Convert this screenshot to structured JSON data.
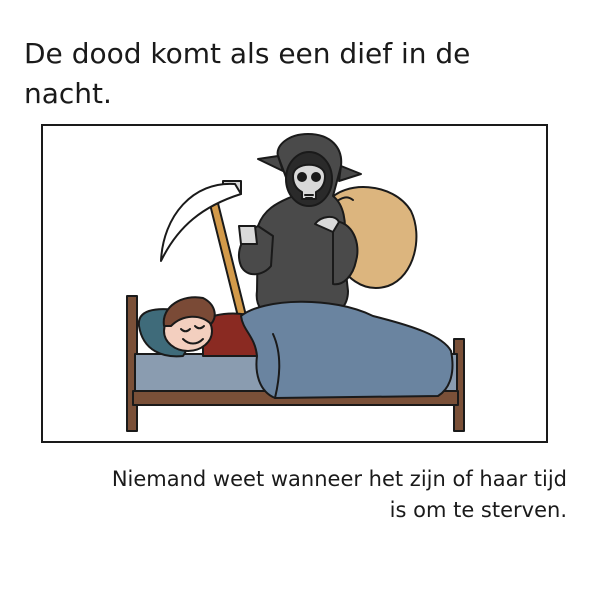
{
  "title": "De dood komt als een dief in de nacht.",
  "caption": "Niemand weet wanneer het zijn of haar tijd is om te sterven.",
  "illustration": {
    "figures": [
      "grim-reaper",
      "scythe",
      "sack",
      "sleeping-person",
      "bed",
      "blanket",
      "pillow"
    ],
    "colors": {
      "robe": "#4a4a4a",
      "skull": "#d9d9d9",
      "scythe_handle": "#d39a4a",
      "sack": "#dcb57e",
      "bed_frame": "#7a5038",
      "blanket": "#6a84a0",
      "sheet": "#8a9cb0",
      "pillow": "#3f6b7a",
      "hair": "#7a4a36",
      "shirt": "#8a2a22",
      "skin": "#f3cfbf"
    }
  }
}
